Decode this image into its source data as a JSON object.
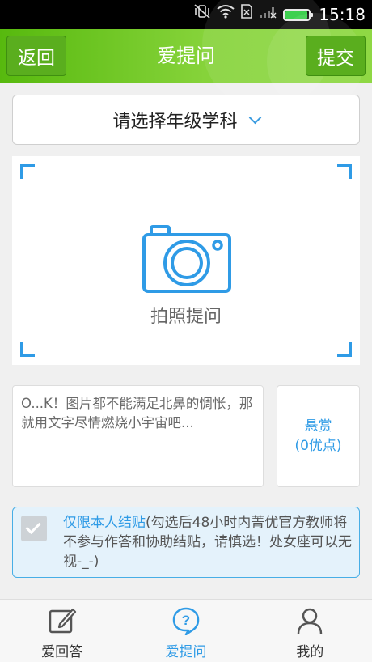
{
  "status_bar": {
    "time": "15:18",
    "battery_level": 0.95
  },
  "header": {
    "back_label": "返回",
    "title": "爱提问",
    "submit_label": "提交"
  },
  "selector": {
    "placeholder": "请选择年级学科"
  },
  "photo": {
    "label": "拍照提问"
  },
  "question": {
    "placeholder": "O...K！图片都不能满足北鼻的惆怅，那就用文字尽情燃烧小宇宙吧..."
  },
  "reward": {
    "label": "悬赏",
    "value": "(0优点)"
  },
  "settle": {
    "checked": false,
    "highlight": "仅限本人结贴",
    "description": "(勾选后48小时内菁优官方教师将不参与作答和协助结贴，请慎选！处女座可以无视-_-)"
  },
  "bottom_nav": [
    {
      "label": "爱回答",
      "icon": "pencil-square-icon",
      "active": false
    },
    {
      "label": "爱提问",
      "icon": "question-bubble-icon",
      "active": true
    },
    {
      "label": "我的",
      "icon": "person-icon",
      "active": false
    }
  ],
  "colors": {
    "accent_blue": "#2f9be6",
    "header_green": "#6cc424"
  }
}
